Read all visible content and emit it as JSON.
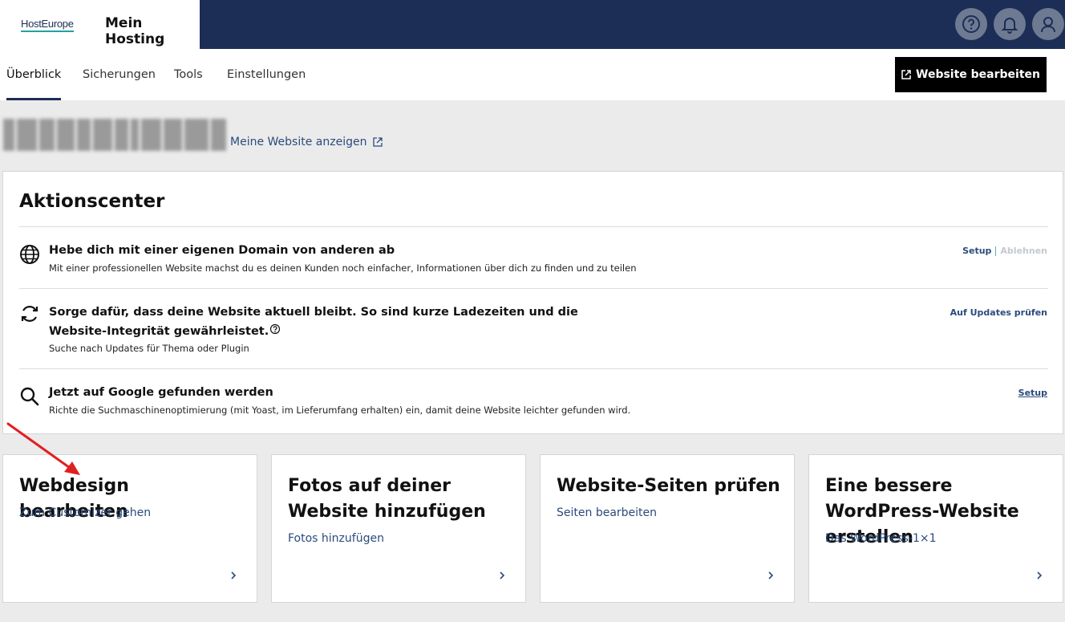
{
  "header": {
    "logo_text": "HostEurope",
    "app_title": "Mein Hosting",
    "icons": [
      "help-icon",
      "bell-icon",
      "user-icon"
    ],
    "bg_color": "#1c2e55"
  },
  "tabs": [
    {
      "label": "Überblick",
      "active": true
    },
    {
      "label": "Sicherungen",
      "active": false
    },
    {
      "label": "Tools",
      "active": false
    },
    {
      "label": "Einstellungen",
      "active": false
    }
  ],
  "cta": {
    "label": "Website bearbeiten",
    "icon": "external-link-icon"
  },
  "site": {
    "view_link": "Meine Website anzeigen"
  },
  "action_center": {
    "title": "Aktionscenter",
    "items": [
      {
        "icon": "globe-icon",
        "title": "Hebe dich mit einer eigenen Domain von anderen ab",
        "subtitle": "Mit einer professionellen Website machst du es deinen Kunden noch einfacher, Informationen über dich zu finden und zu teilen",
        "action_primary": "Setup",
        "action_secondary": "Ablehnen"
      },
      {
        "icon": "refresh-icon",
        "title": "Sorge dafür, dass deine Website aktuell bleibt. So sind kurze Ladezeiten und die Website-Integrität gewährleistet.",
        "subtitle": "Suche nach Updates für Thema oder Plugin",
        "action_primary": "Auf Updates prüfen"
      },
      {
        "icon": "search-icon",
        "title": "Jetzt auf Google gefunden werden",
        "subtitle": "Richte die Suchmaschinenoptimierung (mit Yoast, im Lieferumfang erhalten) ein, damit deine Website leichter gefunden wird.",
        "action_primary": "Setup"
      }
    ]
  },
  "cards": [
    {
      "title": "Webdesign bearbeiten",
      "link": "Zum Customizer gehen"
    },
    {
      "title": "Fotos auf deiner Website hinzufügen",
      "link": "Fotos hinzufügen"
    },
    {
      "title": "Website-Seiten prüfen",
      "link": "Seiten bearbeiten"
    },
    {
      "title": "Eine bessere WordPress-Website erstellen",
      "link": "Das WordPress-1×1"
    }
  ],
  "colors": {
    "accent": "#1c2e55",
    "link": "#2a4b7c",
    "annotation_arrow": "#e02020"
  }
}
